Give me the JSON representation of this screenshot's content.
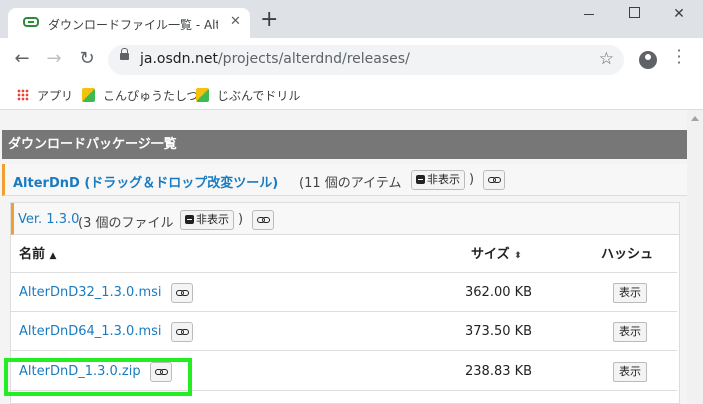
{
  "browser": {
    "tab_title": "ダウンロードファイル一覧 - AlterDnD - OSDN",
    "tab_close": "✕",
    "new_tab": "+",
    "url_host": "ja.osdn.net",
    "url_path": "/projects/alterdnd/releases/",
    "bookmarks": [
      "アプリ",
      "こんぴゅうたしつ",
      "じぶんでドリル"
    ]
  },
  "page": {
    "section_title": "ダウンロードパッケージ一覧",
    "package": {
      "name": "AlterDnD (ドラッグ＆ドロップ改変ツール)",
      "count": "(11 個のアイテム",
      "hide_label": "非表示",
      "close_paren": ")"
    },
    "release": {
      "name": "Ver. 1.3.0",
      "count": "(3 個のファイル",
      "hide_label": "非表示",
      "close_paren": ")"
    },
    "table": {
      "col_name": "名前",
      "col_size": "サイズ",
      "col_hash": "ハッシュ",
      "show_label": "表示",
      "rows": [
        {
          "name": "AlterDnD32_1.3.0.msi",
          "size": "362.00 KB"
        },
        {
          "name": "AlterDnD64_1.3.0.msi",
          "size": "373.50 KB"
        },
        {
          "name": "AlterDnD_1.3.0.zip",
          "size": "238.83 KB"
        }
      ]
    }
  },
  "colors": {
    "highlight": "#22ee22",
    "link": "#1a7bc0",
    "accent": "#f0a030"
  }
}
